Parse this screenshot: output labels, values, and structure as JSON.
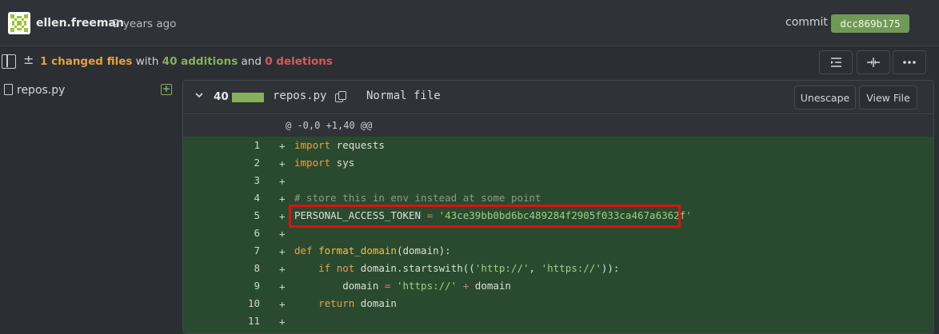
{
  "commit": {
    "author": "ellen.freeman",
    "time": "2 years ago",
    "label": "commit",
    "sha": "dcc869b175"
  },
  "stats": {
    "changed": "1 changed files",
    "with": " with ",
    "additions": "40 additions",
    "and": " and ",
    "deletions": "0 deletions"
  },
  "file_tree": {
    "files": [
      {
        "name": "repos.py",
        "status": "added"
      }
    ]
  },
  "diff": {
    "add_count": "40",
    "filename": "repos.py",
    "file_mode": "Normal file",
    "unescape_label": "Unescape",
    "view_file_label": "View File",
    "hunk_header": "@ -0,0 +1,40 @@",
    "lines": [
      {
        "n": "1",
        "code": "import requests"
      },
      {
        "n": "2",
        "code": "import sys"
      },
      {
        "n": "3",
        "code": ""
      },
      {
        "n": "4",
        "code": "# store this in env instead at some point"
      },
      {
        "n": "5",
        "code": "PERSONAL_ACCESS_TOKEN = '43ce39bb0bd6bc489284f2905f033ca467a6362f'"
      },
      {
        "n": "6",
        "code": ""
      },
      {
        "n": "7",
        "code": "def format_domain(domain):"
      },
      {
        "n": "8",
        "code": "    if not domain.startswith(('http://', 'https://')):"
      },
      {
        "n": "9",
        "code": "        domain = 'https://' + domain"
      },
      {
        "n": "10",
        "code": "    return domain"
      },
      {
        "n": "11",
        "code": ""
      }
    ]
  },
  "colors": {
    "accent_green": "#86b05d",
    "deletions_red": "#d55b5b",
    "changed_orange": "#e0a534",
    "added_line_bg": "#2a4a30",
    "highlight_red": "#e01010"
  }
}
